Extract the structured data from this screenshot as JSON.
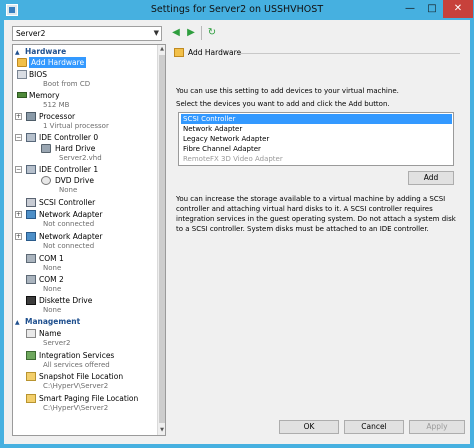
{
  "window": {
    "title": "Settings for Server2 on USSHVHOST",
    "minimize": "—",
    "maximize": "□",
    "close": "✕"
  },
  "toolbar": {
    "vm_selected": "Server2",
    "back": "◀",
    "forward": "▶",
    "refresh": "↻"
  },
  "tree": {
    "hardware_header": "Hardware",
    "management_header": "Management",
    "hardware": [
      {
        "label": "Add Hardware",
        "sub": ""
      },
      {
        "label": "BIOS",
        "sub": "Boot from CD"
      },
      {
        "label": "Memory",
        "sub": "512 MB"
      },
      {
        "label": "Processor",
        "sub": "1 Virtual processor"
      },
      {
        "label": "IDE Controller 0",
        "sub": ""
      },
      {
        "label": "Hard Drive",
        "sub": "Server2.vhd"
      },
      {
        "label": "IDE Controller 1",
        "sub": ""
      },
      {
        "label": "DVD Drive",
        "sub": "None"
      },
      {
        "label": "SCSI Controller",
        "sub": ""
      },
      {
        "label": "Network Adapter",
        "sub": "Not connected"
      },
      {
        "label": "Network Adapter",
        "sub": "Not connected"
      },
      {
        "label": "COM 1",
        "sub": "None"
      },
      {
        "label": "COM 2",
        "sub": "None"
      },
      {
        "label": "Diskette Drive",
        "sub": "None"
      }
    ],
    "management": [
      {
        "label": "Name",
        "sub": "Server2"
      },
      {
        "label": "Integration Services",
        "sub": "All services offered"
      },
      {
        "label": "Snapshot File Location",
        "sub": "C:\\HyperV\\Server2"
      },
      {
        "label": "Smart Paging File Location",
        "sub": "C:\\HyperV\\Server2"
      }
    ]
  },
  "panel": {
    "header": "Add Hardware",
    "intro": "You can use this setting to add devices to your virtual machine.",
    "instruction": "Select the devices you want to add and click the Add button.",
    "devices": [
      {
        "label": "SCSI Controller"
      },
      {
        "label": "Network Adapter"
      },
      {
        "label": "Legacy Network Adapter"
      },
      {
        "label": "Fibre Channel Adapter"
      },
      {
        "label": "RemoteFX 3D Video Adapter"
      }
    ],
    "add_button": "Add",
    "description": "You can increase the storage available to a virtual machine by adding a SCSI controller and attaching virtual hard disks to it. A SCSI controller requires integration services in the guest operating system. Do not attach a system disk to a SCSI controller. System disks must be attached to an IDE controller."
  },
  "footer": {
    "ok": "OK",
    "cancel": "Cancel",
    "apply": "Apply"
  }
}
